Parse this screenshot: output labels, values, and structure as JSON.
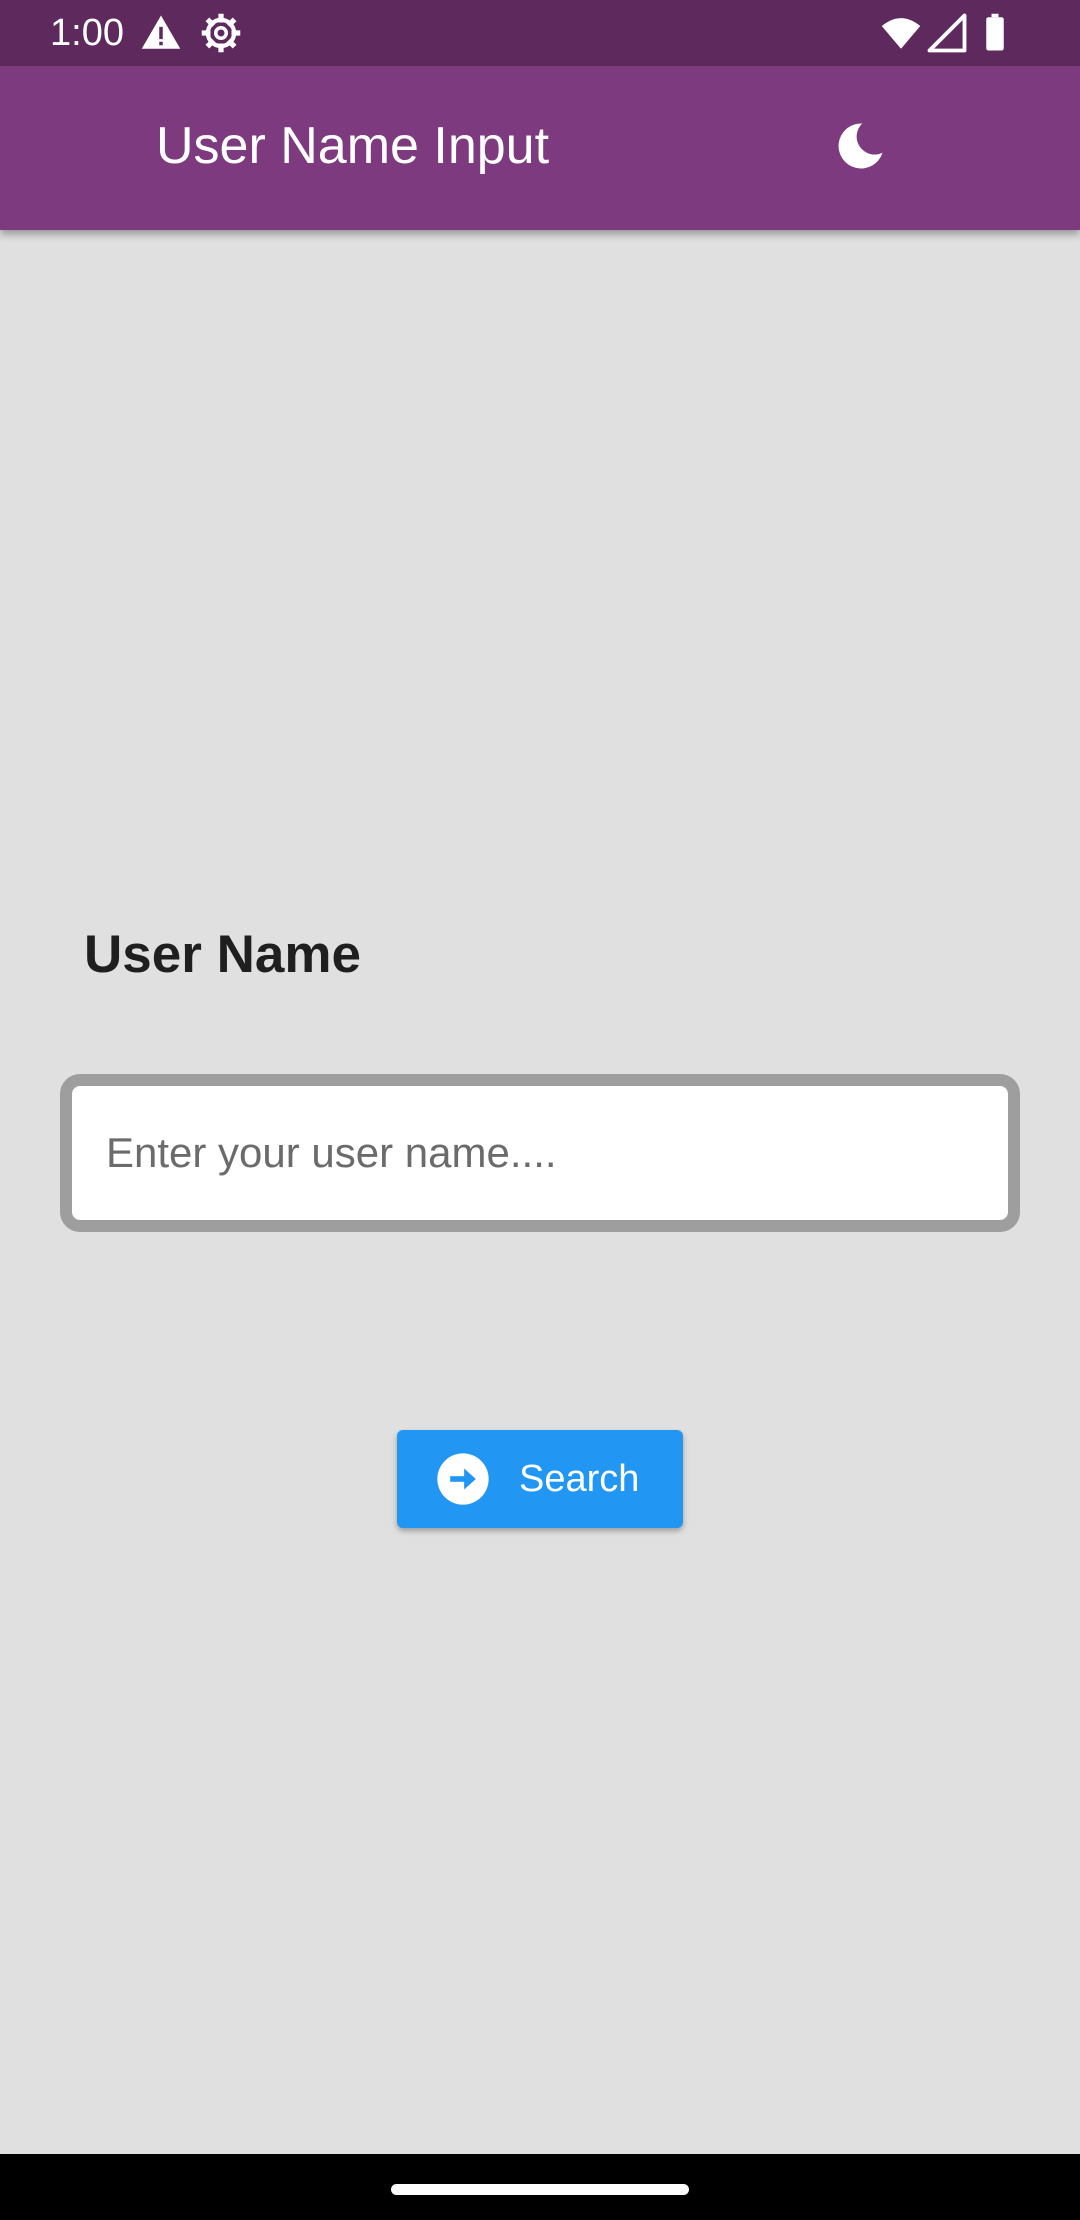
{
  "status_bar": {
    "time": "1:00",
    "left_icons": [
      "warning-icon",
      "settings-gear-icon"
    ],
    "right_icons": [
      "wifi-icon",
      "cell-signal-icon",
      "battery-icon"
    ]
  },
  "app_bar": {
    "title": "User Name Input",
    "theme_toggle_icon": "moon-icon",
    "background_color": "#7e3a7f"
  },
  "form": {
    "label": "User Name",
    "input": {
      "value": "",
      "placeholder": "Enter your user name...."
    },
    "search_button": {
      "label": "Search",
      "icon": "arrow-right-circle-icon",
      "color": "#2196f3"
    }
  },
  "colors": {
    "status_bar": "#5e2a5e",
    "background": "#e0e0e0",
    "input_border": "#9e9e9e"
  }
}
